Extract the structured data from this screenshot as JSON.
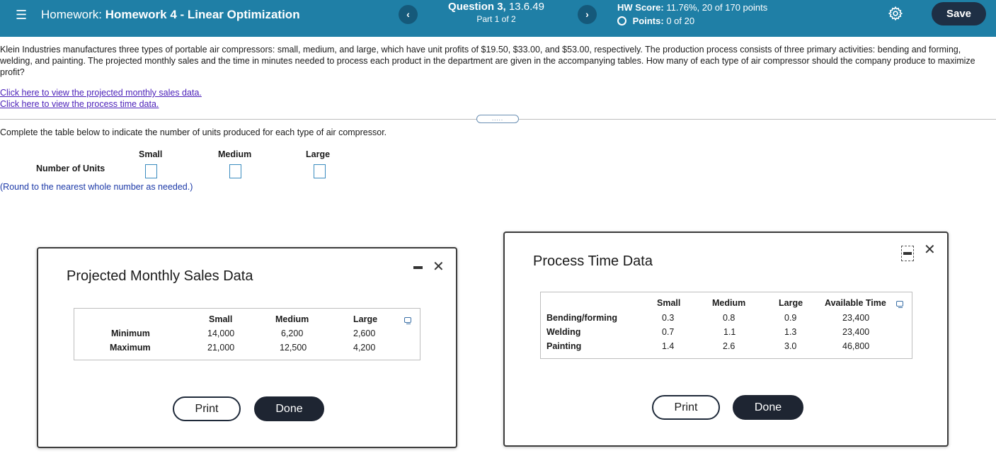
{
  "header": {
    "menu_icon": "menu-icon",
    "homework_prefix": "Homework:",
    "homework_name": "Homework 4 - Linear Optimization",
    "prev_glyph": "‹",
    "next_glyph": "›",
    "question_label": "Question 3,",
    "question_id": "13.6.49",
    "part": "Part 1 of 2",
    "hw_score_label": "HW Score:",
    "hw_score_value": "11.76%, 20 of 170 points",
    "points_label": "Points:",
    "points_value": "0 of 20",
    "settings_icon": "gear-icon",
    "save_label": "Save",
    "colors": {
      "bar": "#1f7fa6",
      "save": "#1e2f45"
    }
  },
  "question": {
    "text": "Klein Industries manufactures three types of portable air compressors: small, medium, and large, which have unit profits of $19.50, $33.00, and $53.00, respectively. The production process consists of three primary activities: bending and forming, welding, and painting. The projected monthly sales and the time in minutes needed to process each product in the department are given in the accompanying tables. How many of each type of air compressor should the company produce to maximize profit?",
    "link_sales": "Click here to view the projected monthly sales data.",
    "link_process": "Click here to view the process time data.",
    "expander": "....."
  },
  "answer": {
    "instruction": "Complete the table below to indicate the number of units produced for each type of air compressor.",
    "columns": [
      "Small",
      "Medium",
      "Large"
    ],
    "row_label": "Number of Units",
    "values": [
      "",
      "",
      ""
    ],
    "note": "(Round to the nearest whole number as needed.)"
  },
  "sales_popup": {
    "title": "Projected Monthly Sales Data",
    "minimize_icon": "minimize-icon",
    "close_icon": "close-icon",
    "close_glyph": "✕",
    "columns": [
      "Small",
      "Medium",
      "Large"
    ],
    "rows": [
      {
        "label": "Minimum",
        "values": [
          "14,000",
          "6,200",
          "2,600"
        ]
      },
      {
        "label": "Maximum",
        "values": [
          "21,000",
          "12,500",
          "4,200"
        ]
      }
    ],
    "print_label": "Print",
    "done_label": "Done"
  },
  "process_popup": {
    "title": "Process Time Data",
    "maximize_icon": "maximize-icon",
    "close_icon": "close-icon",
    "close_glyph": "✕",
    "columns": [
      "Small",
      "Medium",
      "Large",
      "Available Time"
    ],
    "rows": [
      {
        "label": "Bending/forming",
        "values": [
          "0.3",
          "0.8",
          "0.9",
          "23,400"
        ]
      },
      {
        "label": "Welding",
        "values": [
          "0.7",
          "1.1",
          "1.3",
          "23,400"
        ]
      },
      {
        "label": "Painting",
        "values": [
          "1.4",
          "2.6",
          "3.0",
          "46,800"
        ]
      }
    ],
    "print_label": "Print",
    "done_label": "Done"
  }
}
